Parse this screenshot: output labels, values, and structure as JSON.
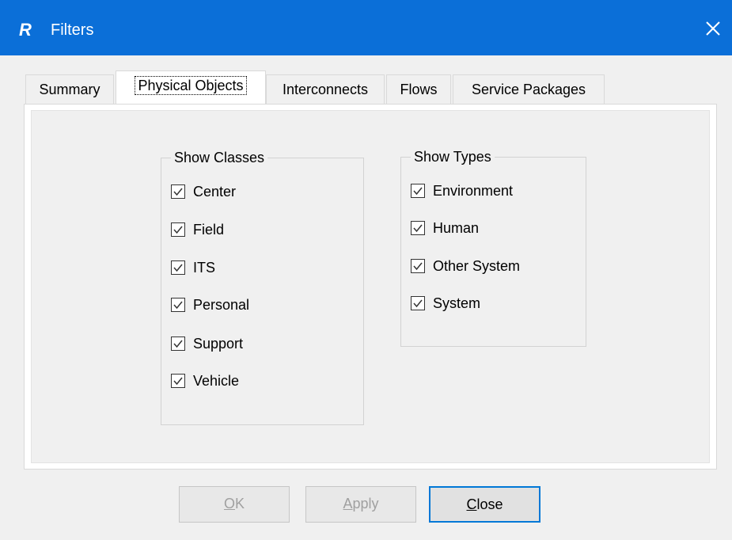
{
  "window": {
    "title": "Filters",
    "app_icon_letter": "R",
    "colors": {
      "titlebar": "#0b6fd8",
      "default_button_border": "#0078d7"
    }
  },
  "tabs": [
    {
      "label": "Summary",
      "active": false
    },
    {
      "label": "Physical Objects",
      "active": true
    },
    {
      "label": "Interconnects",
      "active": false
    },
    {
      "label": "Flows",
      "active": false
    },
    {
      "label": "Service Packages",
      "active": false
    }
  ],
  "show_classes": {
    "label": "Show Classes",
    "items": [
      {
        "label": "Center",
        "checked": true
      },
      {
        "label": "Field",
        "checked": true
      },
      {
        "label": "ITS",
        "checked": true
      },
      {
        "label": "Personal",
        "checked": true
      },
      {
        "label": "Support",
        "checked": true
      },
      {
        "label": "Vehicle",
        "checked": true
      }
    ]
  },
  "show_types": {
    "label": "Show Types",
    "items": [
      {
        "label": "Environment",
        "checked": true
      },
      {
        "label": "Human",
        "checked": true
      },
      {
        "label": "Other System",
        "checked": true
      },
      {
        "label": "System",
        "checked": true
      }
    ]
  },
  "buttons": {
    "ok": {
      "mnemonic": "O",
      "rest": "K",
      "enabled": false
    },
    "apply": {
      "mnemonic": "A",
      "rest": "pply",
      "enabled": false
    },
    "close": {
      "mnemonic": "C",
      "rest": "lose",
      "enabled": true
    }
  }
}
